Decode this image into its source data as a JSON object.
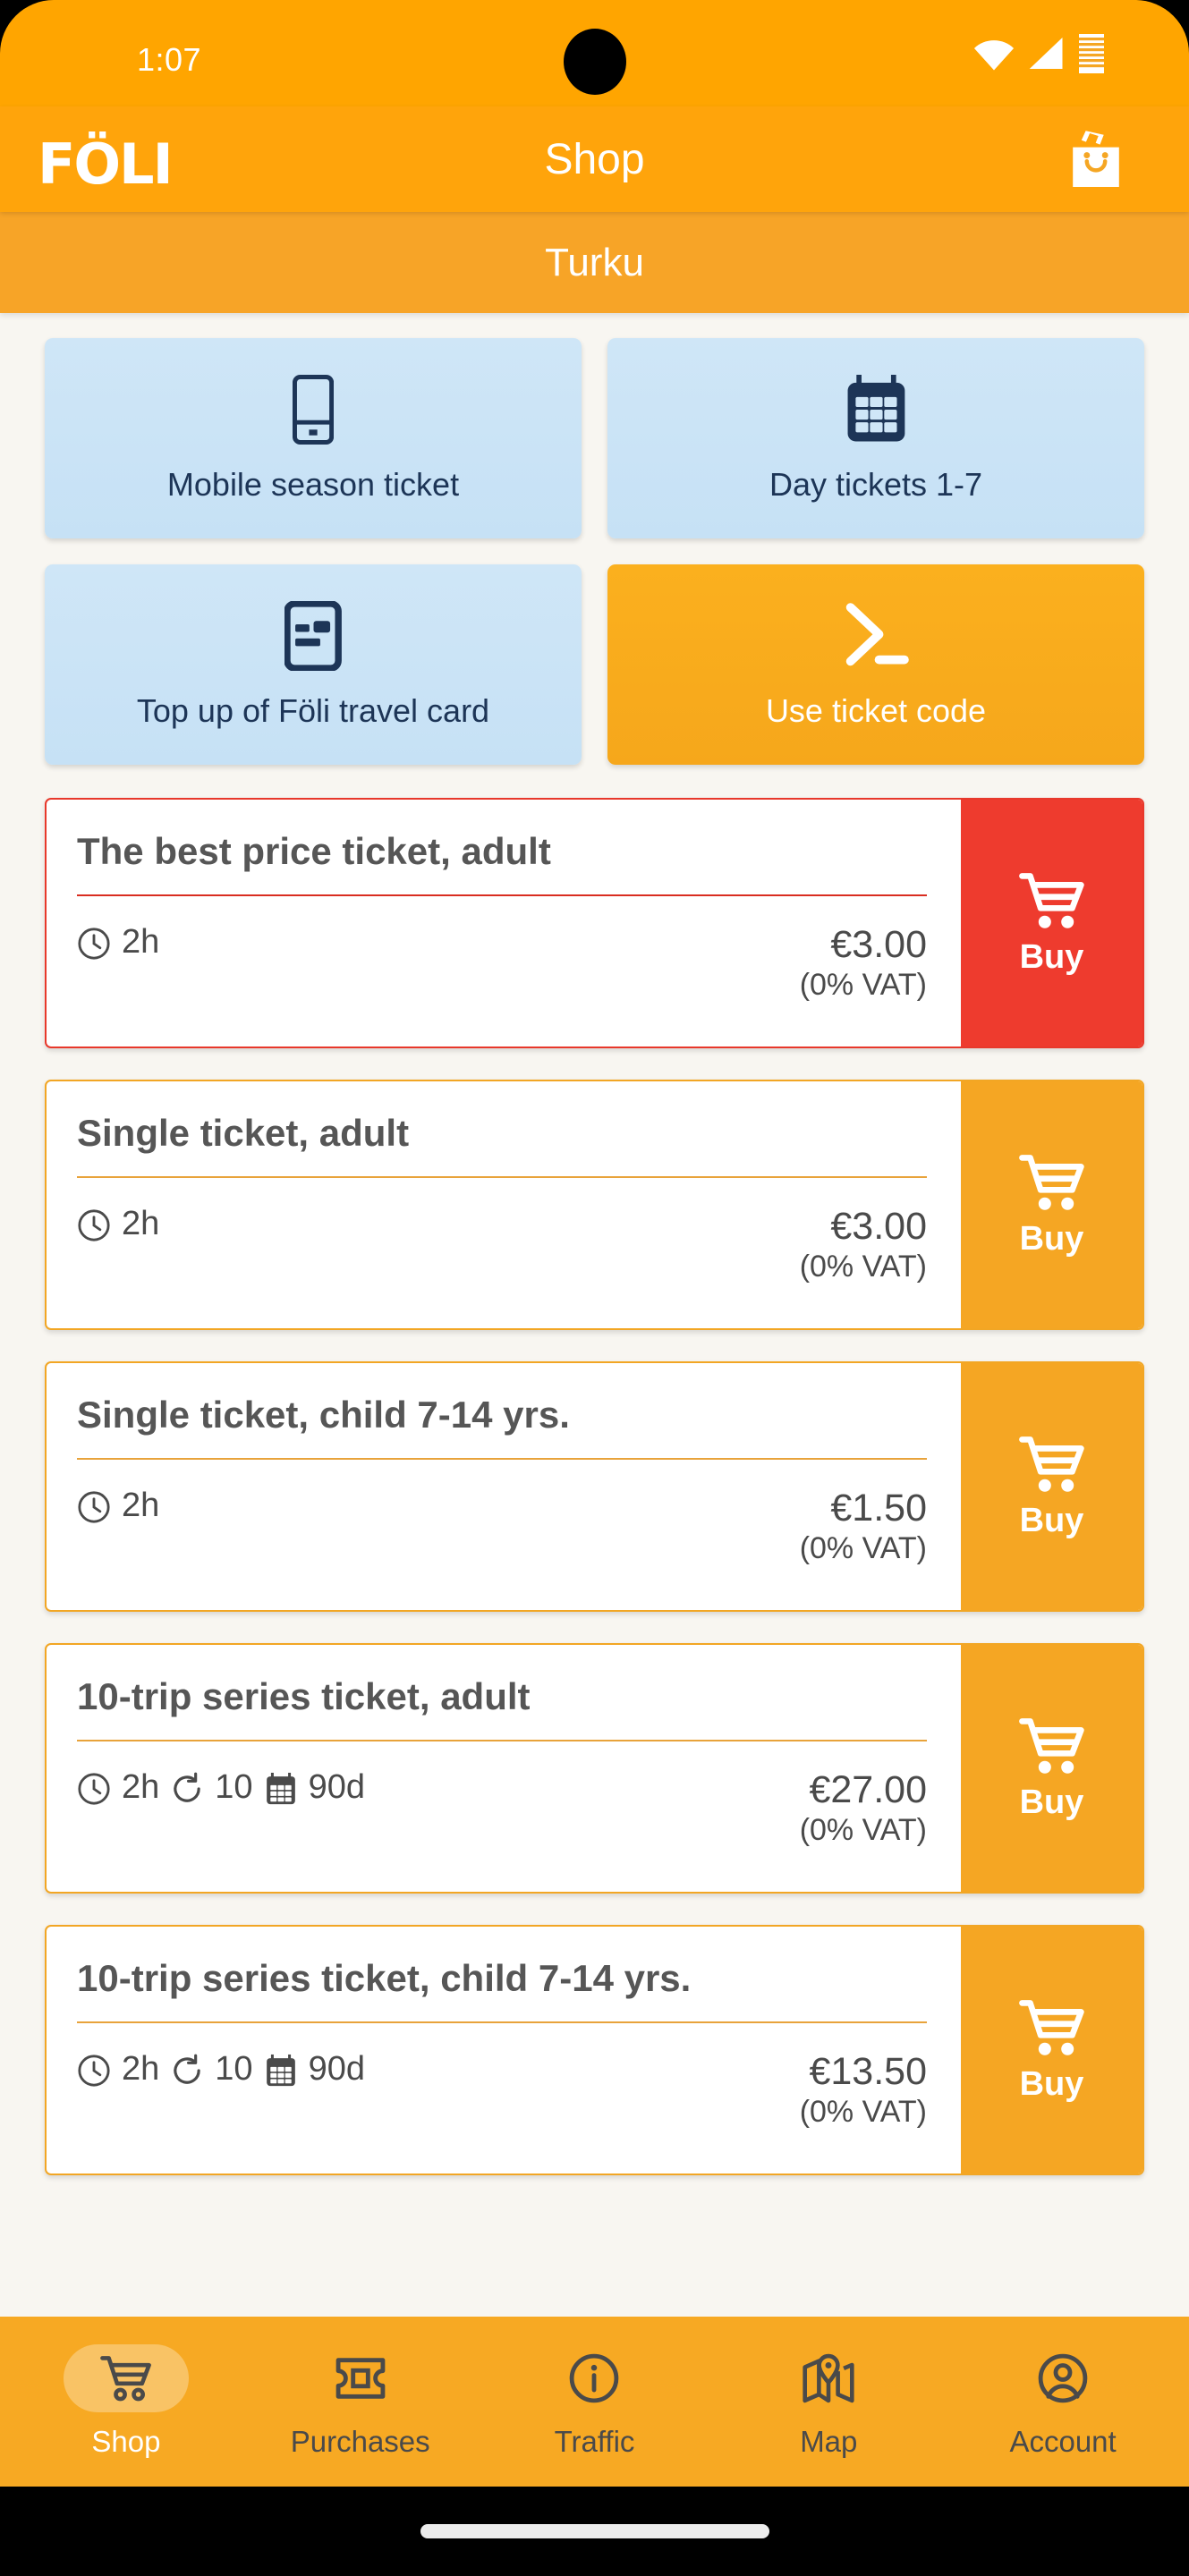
{
  "status_bar": {
    "time": "1:07",
    "icons": [
      "wifi-icon",
      "cellular-signal-icon",
      "battery-icon"
    ]
  },
  "app_bar": {
    "logo": "FÖLI",
    "title": "Shop",
    "bag_icon": "shopping-bag-icon"
  },
  "region_bar": {
    "region": "Turku"
  },
  "categories": [
    {
      "label": "Mobile season ticket",
      "icon": "mobile-phone-icon",
      "style": "blue"
    },
    {
      "label": "Day tickets 1-7",
      "icon": "calendar-icon",
      "style": "blue"
    },
    {
      "label": "Top up of Föli travel card",
      "icon": "travel-card-icon",
      "style": "blue"
    },
    {
      "label": "Use ticket code",
      "icon": "terminal-prompt-icon",
      "style": "orange"
    }
  ],
  "tickets": [
    {
      "title": "The best price ticket, adult",
      "duration": "2h",
      "trips": null,
      "validity": null,
      "price": "€3.00",
      "vat": "(0% VAT)",
      "buy_label": "Buy",
      "highlight": true
    },
    {
      "title": "Single ticket, adult",
      "duration": "2h",
      "trips": null,
      "validity": null,
      "price": "€3.00",
      "vat": "(0% VAT)",
      "buy_label": "Buy",
      "highlight": false
    },
    {
      "title": "Single ticket, child 7-14 yrs.",
      "duration": "2h",
      "trips": null,
      "validity": null,
      "price": "€1.50",
      "vat": "(0% VAT)",
      "buy_label": "Buy",
      "highlight": false
    },
    {
      "title": "10-trip series ticket, adult",
      "duration": "2h",
      "trips": "10",
      "validity": "90d",
      "price": "€27.00",
      "vat": "(0% VAT)",
      "buy_label": "Buy",
      "highlight": false
    },
    {
      "title": "10-trip series ticket, child 7-14 yrs.",
      "duration": "2h",
      "trips": "10",
      "validity": "90d",
      "price": "€13.50",
      "vat": "(0% VAT)",
      "buy_label": "Buy",
      "highlight": false
    }
  ],
  "bottom_nav": {
    "active": "Shop",
    "items": [
      {
        "label": "Shop",
        "icon": "shopping-cart-icon"
      },
      {
        "label": "Purchases",
        "icon": "ticket-icon"
      },
      {
        "label": "Traffic",
        "icon": "info-circle-icon"
      },
      {
        "label": "Map",
        "icon": "map-pin-icon"
      },
      {
        "label": "Account",
        "icon": "person-circle-icon"
      }
    ]
  },
  "colors": {
    "brand_orange": "#F5A623",
    "statusbar_orange": "#FFA500",
    "appbar_orange": "#FFA40B",
    "regionbar_orange": "#F7A427",
    "highlight_red": "#EE3B2E",
    "tile_blue": "#CFE6F7",
    "tile_icon_navy": "#1D3557",
    "page_background": "#F8F6F1",
    "text_grey": "#565656"
  }
}
